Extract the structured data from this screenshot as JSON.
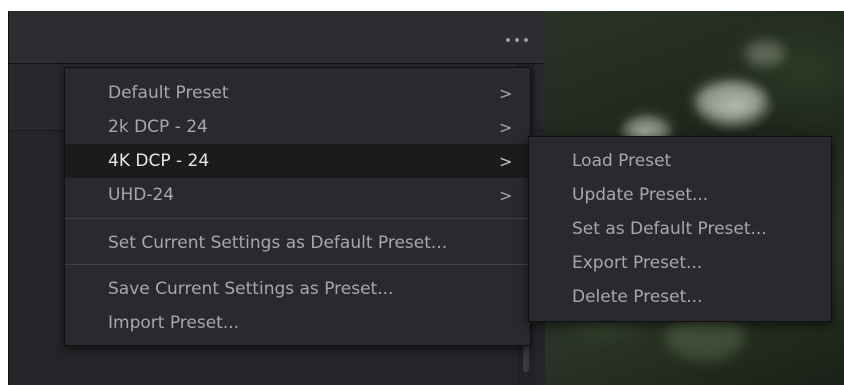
{
  "toolbar": {
    "options_icon": "ellipsis-icon"
  },
  "menu": {
    "items": [
      {
        "label": "Default Preset",
        "submenu_icon": "chevron-right-icon",
        "chevron": ">"
      },
      {
        "label": "2k DCP - 24",
        "submenu_icon": "chevron-right-icon",
        "chevron": ">"
      },
      {
        "label": "4K DCP - 24",
        "submenu_icon": "chevron-right-icon",
        "chevron": ">",
        "active": true
      },
      {
        "label": "UHD-24",
        "submenu_icon": "chevron-right-icon",
        "chevron": ">"
      }
    ],
    "set_default_label": "Set Current Settings as Default Preset...",
    "save_label": "Save Current Settings as Preset...",
    "import_label": "Import Preset..."
  },
  "submenu": {
    "items": [
      {
        "label": "Load Preset"
      },
      {
        "label": "Update Preset..."
      },
      {
        "label": "Set as Default Preset..."
      },
      {
        "label": "Export Preset..."
      },
      {
        "label": "Delete Preset..."
      }
    ]
  },
  "colors": {
    "menu_background": "#29292e",
    "menu_text": "#a7a7ad",
    "menu_text_active": "#e8e8ec",
    "active_row": "#1b1b1e",
    "panel_background": "#26262a"
  }
}
